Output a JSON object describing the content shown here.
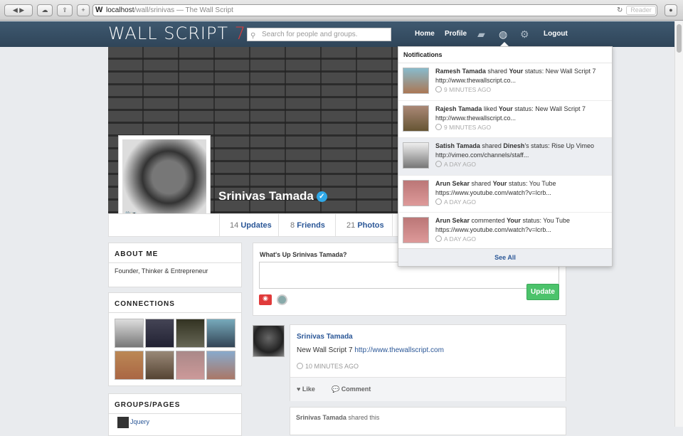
{
  "browser": {
    "url_host": "localhost",
    "url_path": "/wall/srinivas",
    "url_title": "— The Wall Script",
    "reader_label": "Reader"
  },
  "nav": {
    "logo_text": "WALL SCRIPT",
    "logo_number": "7",
    "search_placeholder": "Search for people and groups.",
    "home": "Home",
    "profile": "Profile",
    "logout": "Logout"
  },
  "profile": {
    "name": "Srinivas Tamada",
    "tabs": [
      {
        "count": "14",
        "label": "Updates"
      },
      {
        "count": "8",
        "label": "Friends"
      },
      {
        "count": "21",
        "label": "Photos"
      }
    ]
  },
  "about": {
    "title": "ABOUT ME",
    "text": "Founder, Thinker & Entrepreneur"
  },
  "connections": {
    "title": "CONNECTIONS"
  },
  "groups": {
    "title": "GROUPS/PAGES",
    "first_item": "Jquery"
  },
  "composer": {
    "prompt": "What's Up Srinivas Tamada?",
    "button": "Update"
  },
  "post": {
    "author": "Srinivas Tamada",
    "text": "New Wall Script 7",
    "link": "http://www.thewallscript.com",
    "time": "10 MINUTES AGO",
    "like": "Like",
    "comment": "Comment"
  },
  "shared": {
    "author": "Srinivas Tamada",
    "action": "shared this"
  },
  "notifications": {
    "title": "Notifications",
    "see_all": "See All",
    "items": [
      {
        "user": "Ramesh Tamada",
        "verb": "shared",
        "owner": "Your",
        "suffix": "status: New Wall Script 7",
        "detail": "http://www.thewallscript.co...",
        "time": "9 MINUTES AGO"
      },
      {
        "user": "Rajesh Tamada",
        "verb": "liked",
        "owner": "Your",
        "suffix": "status: New Wall Script 7",
        "detail": "http://www.thewallscript.co...",
        "time": "9 MINUTES AGO"
      },
      {
        "user": "Satish Tamada",
        "verb": "shared",
        "owner": "Dinesh",
        "suffix": "'s status: Rise Up Vimeo",
        "detail": "http://vimeo.com/channels/staff...",
        "time": "A DAY AGO"
      },
      {
        "user": "Arun Sekar",
        "verb": "shared",
        "owner": "Your",
        "suffix": "status: You Tube",
        "detail": "https://www.youtube.com/watch?v=lcrb...",
        "time": "A DAY AGO"
      },
      {
        "user": "Arun Sekar",
        "verb": "commented",
        "owner": "Your",
        "suffix": "status: You Tube",
        "detail": "https://www.youtube.com/watch?v=lcrb...",
        "time": "A DAY AGO"
      }
    ]
  }
}
